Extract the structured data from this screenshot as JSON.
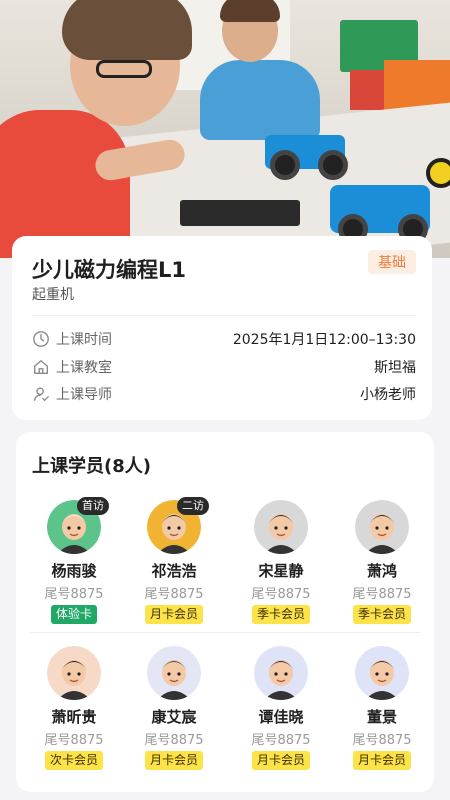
{
  "course": {
    "title": "少儿磁力编程L1",
    "subtitle": "起重机",
    "level": "基础",
    "rows": [
      {
        "icon": "clock-icon",
        "label": "上课时间",
        "value": "2025年1月1日12:00–13:30"
      },
      {
        "icon": "home-icon",
        "label": "上课教室",
        "value": "斯坦福"
      },
      {
        "icon": "teacher-icon",
        "label": "上课导师",
        "value": "小杨老师"
      }
    ]
  },
  "students": {
    "title": "上课学员(8人)",
    "list": [
      {
        "name": "杨雨骏",
        "tail": "尾号8875",
        "tag": "体验卡",
        "tag_style": "trial",
        "badge": "首访",
        "avatar_color": "#5cc48a"
      },
      {
        "name": "祁浩浩",
        "tail": "尾号8875",
        "tag": "月卡会员",
        "tag_style": "member",
        "badge": "二访",
        "avatar_color": "#f0b432"
      },
      {
        "name": "宋星静",
        "tail": "尾号8875",
        "tag": "季卡会员",
        "tag_style": "member",
        "badge": "",
        "avatar_color": "#d8d8d8"
      },
      {
        "name": "萧鸿",
        "tail": "尾号8875",
        "tag": "季卡会员",
        "tag_style": "member",
        "badge": "",
        "avatar_color": "#d8d8d8"
      },
      {
        "name": "萧昕贵",
        "tail": "尾号8875",
        "tag": "次卡会员",
        "tag_style": "member",
        "badge": "",
        "avatar_color": "#f7d9c8"
      },
      {
        "name": "康艾宸",
        "tail": "尾号8875",
        "tag": "月卡会员",
        "tag_style": "member",
        "badge": "",
        "avatar_color": "#e3e6f5"
      },
      {
        "name": "谭佳晓",
        "tail": "尾号8875",
        "tag": "月卡会员",
        "tag_style": "member",
        "badge": "",
        "avatar_color": "#dfe3f7"
      },
      {
        "name": "董景",
        "tail": "尾号8875",
        "tag": "月卡会员",
        "tag_style": "member",
        "badge": "",
        "avatar_color": "#dfe3f7"
      }
    ]
  },
  "colors": {
    "level_tag_bg": "#fdeee4",
    "level_tag_text": "#ef7a3a",
    "trial_tag": "#1fa866",
    "member_tag": "#fde34a"
  }
}
